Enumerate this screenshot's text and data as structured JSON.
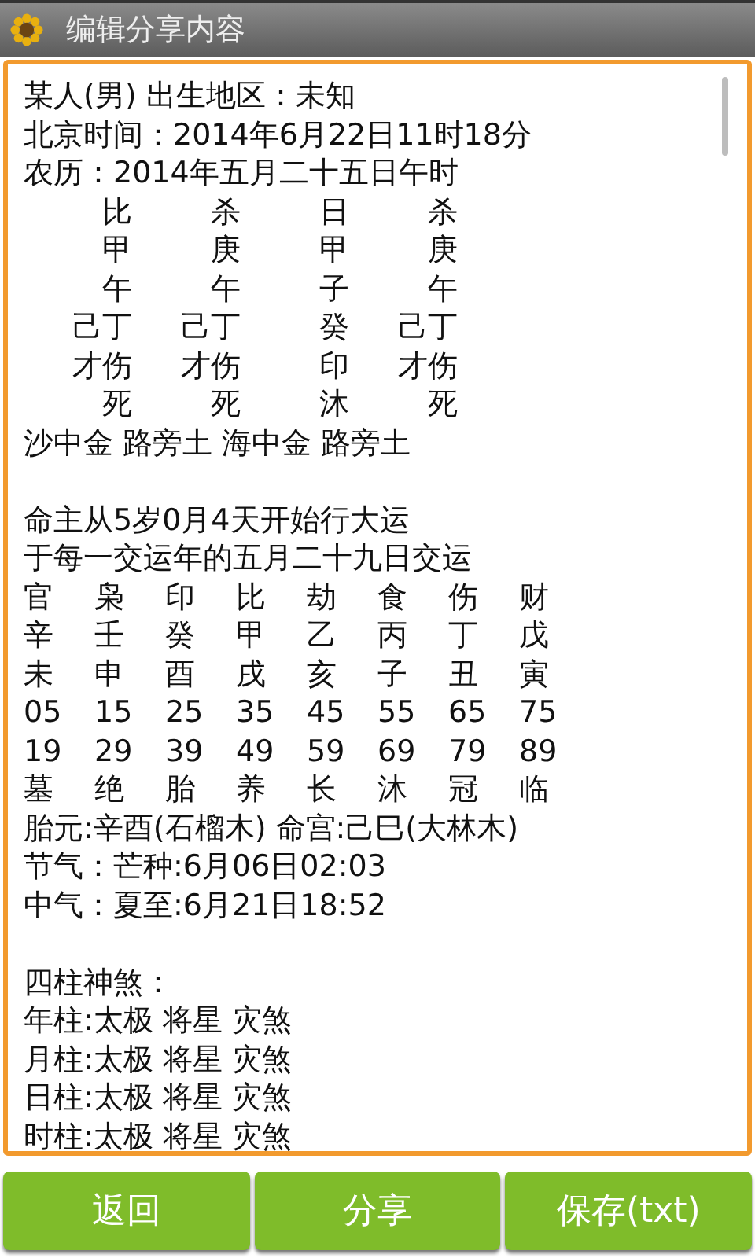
{
  "window": {
    "title": "编辑分享内容"
  },
  "editor": {
    "lines": [
      {
        "kind": "text",
        "text": "某人(男) 出生地区：未知"
      },
      {
        "kind": "text",
        "text": "北京时间：2014年6月22日11时18分"
      },
      {
        "kind": "text",
        "text": "农历：2014年五月二十五日午时"
      },
      {
        "kind": "pillars",
        "cells": [
          "比",
          "杀",
          "日",
          "杀"
        ]
      },
      {
        "kind": "pillars",
        "cells": [
          "甲",
          "庚",
          "甲",
          "庚"
        ]
      },
      {
        "kind": "pillars",
        "cells": [
          "午",
          "午",
          "子",
          "午"
        ]
      },
      {
        "kind": "pillars",
        "cells": [
          "己丁",
          "己丁",
          "癸",
          "己丁"
        ]
      },
      {
        "kind": "pillars",
        "cells": [
          "才伤",
          "才伤",
          "印",
          "才伤"
        ]
      },
      {
        "kind": "pillars",
        "cells": [
          "死",
          "死",
          "沐",
          "死"
        ]
      },
      {
        "kind": "text",
        "text": "沙中金 路旁土 海中金 路旁土"
      },
      {
        "kind": "blank"
      },
      {
        "kind": "text",
        "text": "命主从5岁0月4天开始行大运"
      },
      {
        "kind": "text",
        "text": "于每一交运年的五月二十九日交运"
      },
      {
        "kind": "luck",
        "cells": [
          "官",
          "枭",
          "印",
          "比",
          "劫",
          "食",
          "伤",
          "财"
        ]
      },
      {
        "kind": "luck",
        "cells": [
          "辛",
          "壬",
          "癸",
          "甲",
          "乙",
          "丙",
          "丁",
          "戊"
        ]
      },
      {
        "kind": "luck",
        "cells": [
          "未",
          "申",
          "酉",
          "戌",
          "亥",
          "子",
          "丑",
          "寅"
        ]
      },
      {
        "kind": "luck",
        "cells": [
          "05",
          "15",
          "25",
          "35",
          "45",
          "55",
          "65",
          "75"
        ]
      },
      {
        "kind": "luck",
        "cells": [
          "19",
          "29",
          "39",
          "49",
          "59",
          "69",
          "79",
          "89"
        ]
      },
      {
        "kind": "luck",
        "cells": [
          "墓",
          "绝",
          "胎",
          "养",
          "长",
          "沐",
          "冠",
          "临"
        ]
      },
      {
        "kind": "text",
        "text": "胎元:辛酉(石榴木) 命宫:己巳(大林木)"
      },
      {
        "kind": "text",
        "text": "节气：芒种:6月06日02:03"
      },
      {
        "kind": "text",
        "text": "中气：夏至:6月21日18:52"
      },
      {
        "kind": "blank"
      },
      {
        "kind": "text",
        "text": "四柱神煞："
      },
      {
        "kind": "text",
        "text": "年柱:太极 将星 灾煞"
      },
      {
        "kind": "text",
        "text": "月柱:太极 将星 灾煞"
      },
      {
        "kind": "text",
        "text": "日柱:太极 将星 灾煞"
      },
      {
        "kind": "text",
        "text": "时柱:太极 将星 灾煞"
      }
    ]
  },
  "buttons": [
    "返回",
    "分享",
    "保存(txt)"
  ]
}
